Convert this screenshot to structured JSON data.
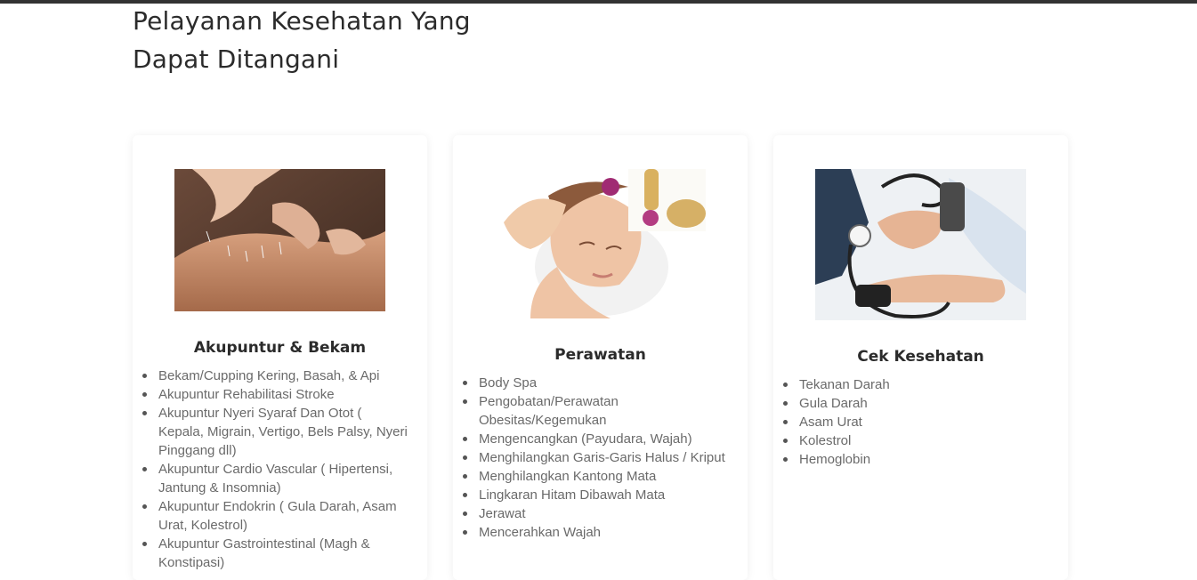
{
  "section": {
    "heading": "Pelayanan Kesehatan Yang Dapat Ditangani"
  },
  "cards": [
    {
      "title": "Akupuntur & Bekam",
      "image_icon": "acupuncture-photo",
      "items": [
        "Bekam/Cupping Kering, Basah, & Api",
        "Akupuntur Rehabilitasi Stroke",
        "Akupuntur Nyeri Syaraf Dan Otot ( Kepala, Migrain, Vertigo, Bels Palsy, Nyeri Pinggang dll)",
        "Akupuntur Cardio Vascular ( Hipertensi, Jantung & Insomnia)",
        "Akupuntur Endokrin ( Gula Darah, Asam Urat, Kolestrol)",
        "Akupuntur Gastrointestinal (Magh & Konstipasi)"
      ]
    },
    {
      "title": "Perawatan",
      "image_icon": "facial-massage-photo",
      "items": [
        "Body Spa",
        "Pengobatan/Perawatan Obesitas/Kegemukan",
        "Mengencangkan (Payudara, Wajah)",
        "Menghilangkan Garis-Garis Halus / Kriput",
        "Menghilangkan Kantong Mata",
        "Lingkaran Hitam Dibawah Mata",
        "Jerawat",
        "Mencerahkan Wajah"
      ]
    },
    {
      "title": "Cek Kesehatan",
      "image_icon": "blood-pressure-photo",
      "items": [
        "Tekanan Darah",
        "Gula Darah",
        "Asam Urat",
        "Kolestrol",
        "Hemoglobin"
      ]
    }
  ],
  "colors": {
    "topbar": "#333333",
    "heading": "#2b2b2b",
    "list_text": "#6a6a6a"
  }
}
